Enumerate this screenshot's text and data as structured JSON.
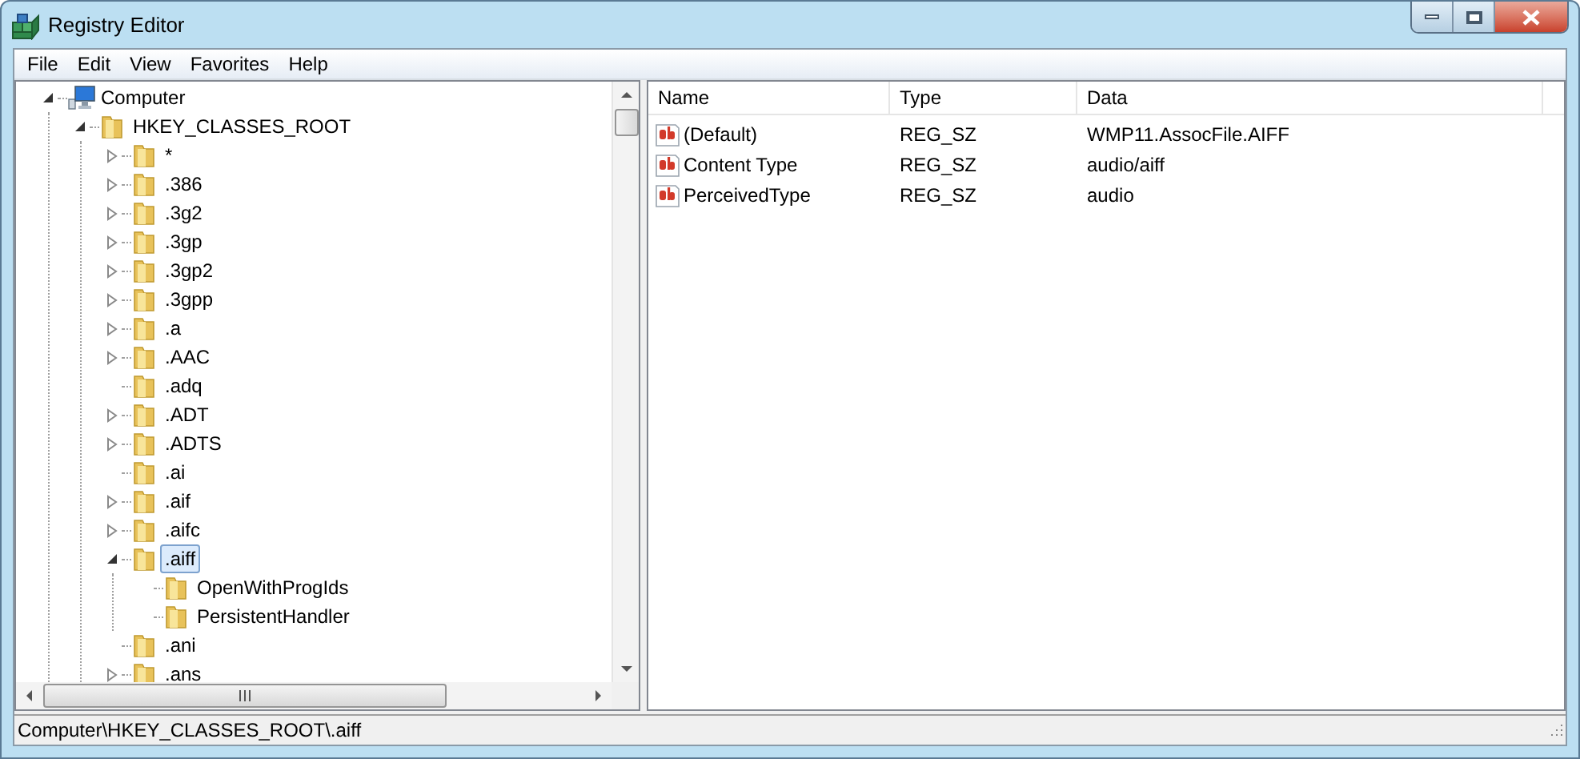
{
  "window": {
    "title": "Registry Editor"
  },
  "menu": [
    "File",
    "Edit",
    "View",
    "Favorites",
    "Help"
  ],
  "tree": [
    {
      "label": "Computer",
      "kind": "computer",
      "expandable": true,
      "expanded": true,
      "selected": false,
      "children": [
        {
          "label": "HKEY_CLASSES_ROOT",
          "kind": "folder",
          "expandable": true,
          "expanded": true,
          "selected": false,
          "children": [
            {
              "label": "*",
              "kind": "folder",
              "expandable": true,
              "expanded": false,
              "selected": false
            },
            {
              "label": ".386",
              "kind": "folder",
              "expandable": true,
              "expanded": false,
              "selected": false
            },
            {
              "label": ".3g2",
              "kind": "folder",
              "expandable": true,
              "expanded": false,
              "selected": false
            },
            {
              "label": ".3gp",
              "kind": "folder",
              "expandable": true,
              "expanded": false,
              "selected": false
            },
            {
              "label": ".3gp2",
              "kind": "folder",
              "expandable": true,
              "expanded": false,
              "selected": false
            },
            {
              "label": ".3gpp",
              "kind": "folder",
              "expandable": true,
              "expanded": false,
              "selected": false
            },
            {
              "label": ".a",
              "kind": "folder",
              "expandable": true,
              "expanded": false,
              "selected": false
            },
            {
              "label": ".AAC",
              "kind": "folder",
              "expandable": true,
              "expanded": false,
              "selected": false
            },
            {
              "label": ".adq",
              "kind": "folder",
              "expandable": false,
              "selected": false
            },
            {
              "label": ".ADT",
              "kind": "folder",
              "expandable": true,
              "expanded": false,
              "selected": false
            },
            {
              "label": ".ADTS",
              "kind": "folder",
              "expandable": true,
              "expanded": false,
              "selected": false
            },
            {
              "label": ".ai",
              "kind": "folder",
              "expandable": false,
              "selected": false
            },
            {
              "label": ".aif",
              "kind": "folder",
              "expandable": true,
              "expanded": false,
              "selected": false
            },
            {
              "label": ".aifc",
              "kind": "folder",
              "expandable": true,
              "expanded": false,
              "selected": false
            },
            {
              "label": ".aiff",
              "kind": "folder",
              "expandable": true,
              "expanded": true,
              "selected": true,
              "children": [
                {
                  "label": "OpenWithProgIds",
                  "kind": "folder",
                  "expandable": false,
                  "selected": false
                },
                {
                  "label": "PersistentHandler",
                  "kind": "folder",
                  "expandable": false,
                  "selected": false
                }
              ]
            },
            {
              "label": ".ani",
              "kind": "folder",
              "expandable": false,
              "selected": false
            },
            {
              "label": ".ans",
              "kind": "folder",
              "expandable": true,
              "expanded": false,
              "selected": false
            }
          ]
        }
      ]
    }
  ],
  "values": {
    "columns": [
      "Name",
      "Type",
      "Data"
    ],
    "rows": [
      {
        "name": "(Default)",
        "type": "REG_SZ",
        "data": "WMP11.AssocFile.AIFF"
      },
      {
        "name": "Content Type",
        "type": "REG_SZ",
        "data": "audio/aiff"
      },
      {
        "name": "PerceivedType",
        "type": "REG_SZ",
        "data": "audio"
      }
    ]
  },
  "status_bar": "Computer\\HKEY_CLASSES_ROOT\\.aiff"
}
